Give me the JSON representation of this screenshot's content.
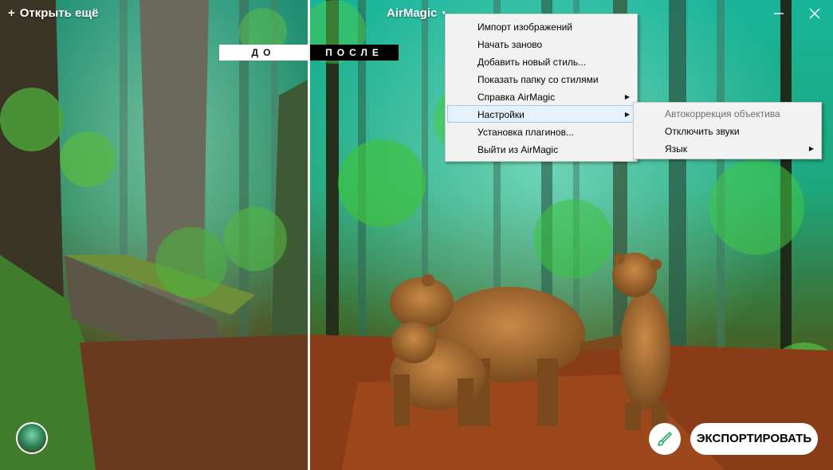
{
  "topbar": {
    "open_more_plus": "+",
    "open_more_label": "Открыть ещё",
    "app_title": "AirMagic",
    "app_title_caret": "▾"
  },
  "compare": {
    "before_label": "ДО",
    "after_label": "ПОСЛЕ"
  },
  "menu": {
    "items": [
      {
        "label": "Импорт изображений"
      },
      {
        "label": "Начать заново"
      },
      {
        "label": "Добавить новый стиль..."
      },
      {
        "label": "Показать папку со стилями"
      },
      {
        "label": "Справка AirMagic",
        "submenu": true
      },
      {
        "label": "Настройки",
        "submenu": true,
        "highlighted": true
      },
      {
        "label": "Установка плагинов..."
      },
      {
        "label": "Выйти из AirMagic"
      }
    ]
  },
  "submenu": {
    "items": [
      {
        "label": "Автокоррекция объектива",
        "disabled": true
      },
      {
        "label": "Отключить звуки"
      },
      {
        "label": "Язык",
        "submenu": true
      }
    ]
  },
  "bottom": {
    "export_label": "ЭКСПОРТИРОВАТЬ",
    "brush_icon": "brush-icon"
  },
  "icons": {
    "submenu_arrow": "▶"
  },
  "colors": {
    "menu_bg": "#f2f2f2",
    "menu_highlight": "#e5f1fb",
    "menu_highlight_border": "#99c9ef",
    "brush_accent": "#2fa86a"
  }
}
